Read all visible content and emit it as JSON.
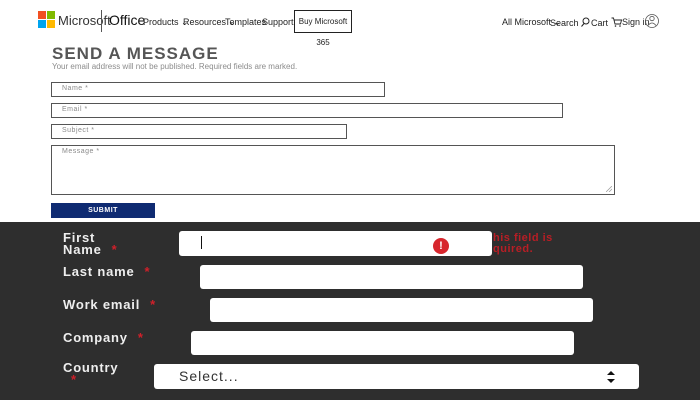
{
  "header": {
    "brand": "Microsoft",
    "product": "Office",
    "nav": [
      "Products ⌄",
      "Resources ⌄",
      "Templates",
      "Support"
    ],
    "buy_button": "Buy Microsoft 365",
    "all_microsoft": "All Microsoft ⌄",
    "search": "Search",
    "cart": "Cart",
    "signin": "Sign in",
    "logo_colors": [
      "#f25022",
      "#7fba00",
      "#00a4ef",
      "#ffb900"
    ]
  },
  "send_message": {
    "title": "SEND A MESSAGE",
    "note": "Your email address will not be published. Required fields are marked.",
    "name_placeholder": "Name *",
    "email_placeholder": "Email *",
    "subject_placeholder": "Subject *",
    "message_placeholder": "Message *",
    "submit": "SUBMIT"
  },
  "contact_form": {
    "first_name_label_1": "First",
    "first_name_label_2": "Name",
    "required_mark": "*",
    "error_line1": "his field is",
    "error_line2": "quired.",
    "last_name_label": "Last name",
    "work_email_label": "Work email",
    "company_label": "Company",
    "country_label": "Country",
    "country_select": "Select...",
    "error_icon_text": "!"
  }
}
